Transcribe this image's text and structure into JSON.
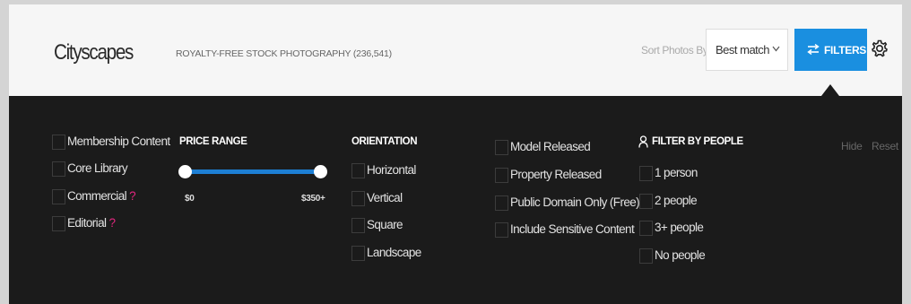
{
  "header": {
    "title": "Cityscapes",
    "subtitle": "ROYALTY-FREE STOCK PHOTOGRAPHY (236,541)",
    "sort_label": "Sort Photos By:",
    "sort_value": "Best match",
    "filters_label": "FILTERS"
  },
  "icons": {
    "filters": "sliders-icon",
    "gear": "gear-icon",
    "people": "person-icon",
    "chevron": "chevron-down-icon"
  },
  "colors": {
    "accent": "#1a8fe0",
    "panel": "#1b1b1b",
    "question": "#e3267f"
  },
  "content_types": [
    {
      "label": "Membership Content",
      "help": ""
    },
    {
      "label": "Core Library",
      "help": ""
    },
    {
      "label": "Commercial",
      "help": "?"
    },
    {
      "label": "Editorial",
      "help": "?"
    }
  ],
  "price": {
    "heading": "PRICE RANGE",
    "min_label": "$0",
    "max_label": "$350+",
    "min_value": 0,
    "max_value": 350
  },
  "orientation": {
    "heading": "ORIENTATION",
    "options": [
      "Horizontal",
      "Vertical",
      "Square",
      "Landscape"
    ]
  },
  "rights": [
    "Model Released",
    "Property Released",
    "Public Domain Only (Free)",
    "Include Sensitive Content"
  ],
  "people": {
    "heading": "FILTER BY PEOPLE",
    "options": [
      "1 person",
      "2 people",
      "3+ people",
      "No people"
    ]
  },
  "actions": {
    "hide": "Hide",
    "reset": "Reset"
  }
}
